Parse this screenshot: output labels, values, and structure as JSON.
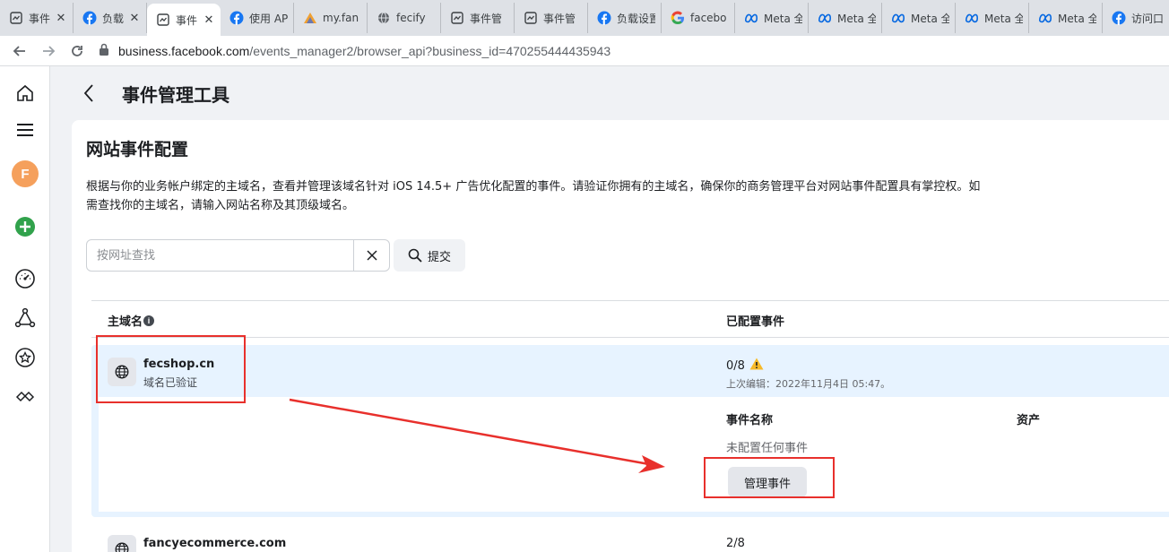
{
  "browser": {
    "tabs": [
      {
        "title": "事件",
        "icon": "events-manager-icon",
        "active": false,
        "close": "✕"
      },
      {
        "title": "负载",
        "icon": "facebook-icon",
        "active": false,
        "close": "✕"
      },
      {
        "title": "事件",
        "icon": "events-manager-icon",
        "active": true,
        "close": "✕"
      },
      {
        "title": "使用 AP",
        "icon": "facebook-icon",
        "active": false,
        "close": ""
      },
      {
        "title": "my.fan",
        "icon": "pma-icon",
        "active": false,
        "close": ""
      },
      {
        "title": "fecify",
        "icon": "globe-icon",
        "active": false,
        "close": ""
      },
      {
        "title": "事件管",
        "icon": "events-manager-icon",
        "active": false,
        "close": ""
      },
      {
        "title": "事件管",
        "icon": "events-manager-icon",
        "active": false,
        "close": ""
      },
      {
        "title": "负载设置",
        "icon": "facebook-icon",
        "active": false,
        "close": ""
      },
      {
        "title": "facebo",
        "icon": "google-icon",
        "active": false,
        "close": ""
      },
      {
        "title": "Meta 全",
        "icon": "meta-icon",
        "active": false,
        "close": ""
      },
      {
        "title": "Meta 全",
        "icon": "meta-icon",
        "active": false,
        "close": ""
      },
      {
        "title": "Meta 全",
        "icon": "meta-icon",
        "active": false,
        "close": ""
      },
      {
        "title": "Meta 全",
        "icon": "meta-icon",
        "active": false,
        "close": ""
      },
      {
        "title": "Meta 全",
        "icon": "meta-icon",
        "active": false,
        "close": ""
      },
      {
        "title": "访问口",
        "icon": "facebook-icon",
        "active": false,
        "close": ""
      }
    ],
    "url_host": "business.facebook.com",
    "url_path": "/events_manager2/browser_api?business_id=470255444435943"
  },
  "rail": {
    "avatar_letter": "F"
  },
  "page": {
    "title": "事件管理工具"
  },
  "card": {
    "title": "网站事件配置",
    "description": "根据与你的业务帐户绑定的主域名，查看并管理该域名针对 iOS 14.5+ 广告优化配置的事件。请验证你拥有的主域名，确保你的商务管理平台对网站事件配置具有掌控权。如需查找你的主域名，请输入网站名称及其顶级域名。",
    "search_placeholder": "按网址查找",
    "submit_label": "提交"
  },
  "table": {
    "col_domain": "主域名",
    "col_events": "已配置事件",
    "rows": [
      {
        "domain": "fecshop.cn",
        "status": "域名已验证",
        "count": "0/8",
        "last_edit": "上次编辑：2022年11月4日 05:47。",
        "event_name_header": "事件名称",
        "asset_header": "资产",
        "empty_text": "未配置任何事件",
        "manage_label": "管理事件"
      },
      {
        "domain": "fancyecommerce.com",
        "count": "2/8"
      }
    ]
  },
  "colors": {
    "accent": "#1877f2",
    "annotation_red": "#e8302c",
    "row_highlight": "#e7f3ff",
    "warning": "#f7b928"
  }
}
